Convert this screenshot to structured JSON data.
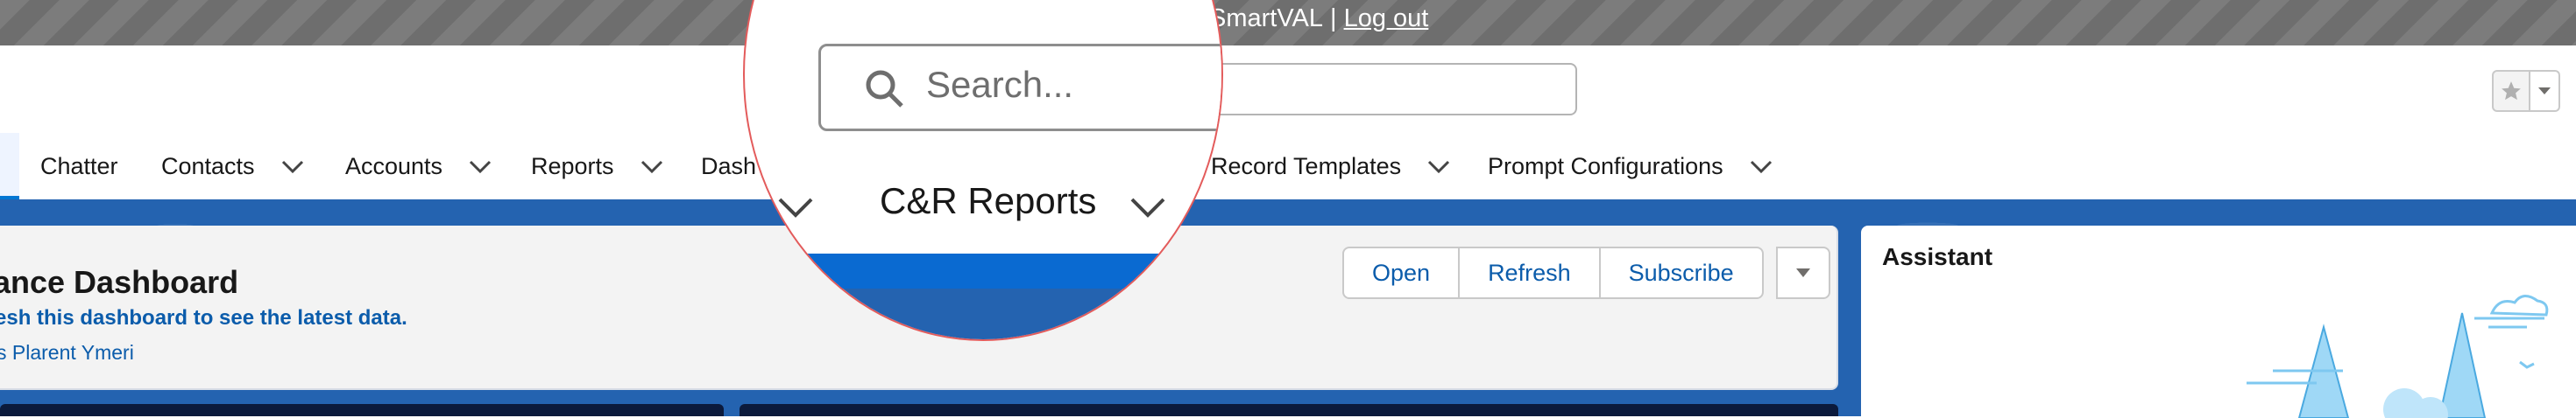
{
  "topbar": {
    "user": "SmartVAL",
    "separator": "|",
    "logout": "Log out"
  },
  "header": {
    "favorites_icon": "star-icon",
    "favorites_menu_icon": "chevron-down-icon"
  },
  "nav": {
    "items": [
      {
        "label": "Chatter"
      },
      {
        "label": "Contacts"
      },
      {
        "label": "Accounts"
      },
      {
        "label": "Reports"
      },
      {
        "label": "Dash"
      },
      {
        "label": "Record Templates"
      },
      {
        "label": "Prompt Configurations"
      }
    ]
  },
  "magnifier": {
    "search_placeholder": "Search...",
    "tab_label": "C&R Reports"
  },
  "dashboard": {
    "title": "ance Dashboard",
    "message": "esh this dashboard to see the latest data.",
    "owner": "s Plarent Ymeri",
    "buttons": {
      "open": "Open",
      "refresh": "Refresh",
      "subscribe": "Subscribe"
    }
  },
  "assistant": {
    "title": "Assistant"
  },
  "colors": {
    "brand_blue": "#0176d3",
    "link_blue": "#0b5cab",
    "banner_blue": "#2463b0",
    "topbar_gray": "#7c7c7c"
  }
}
